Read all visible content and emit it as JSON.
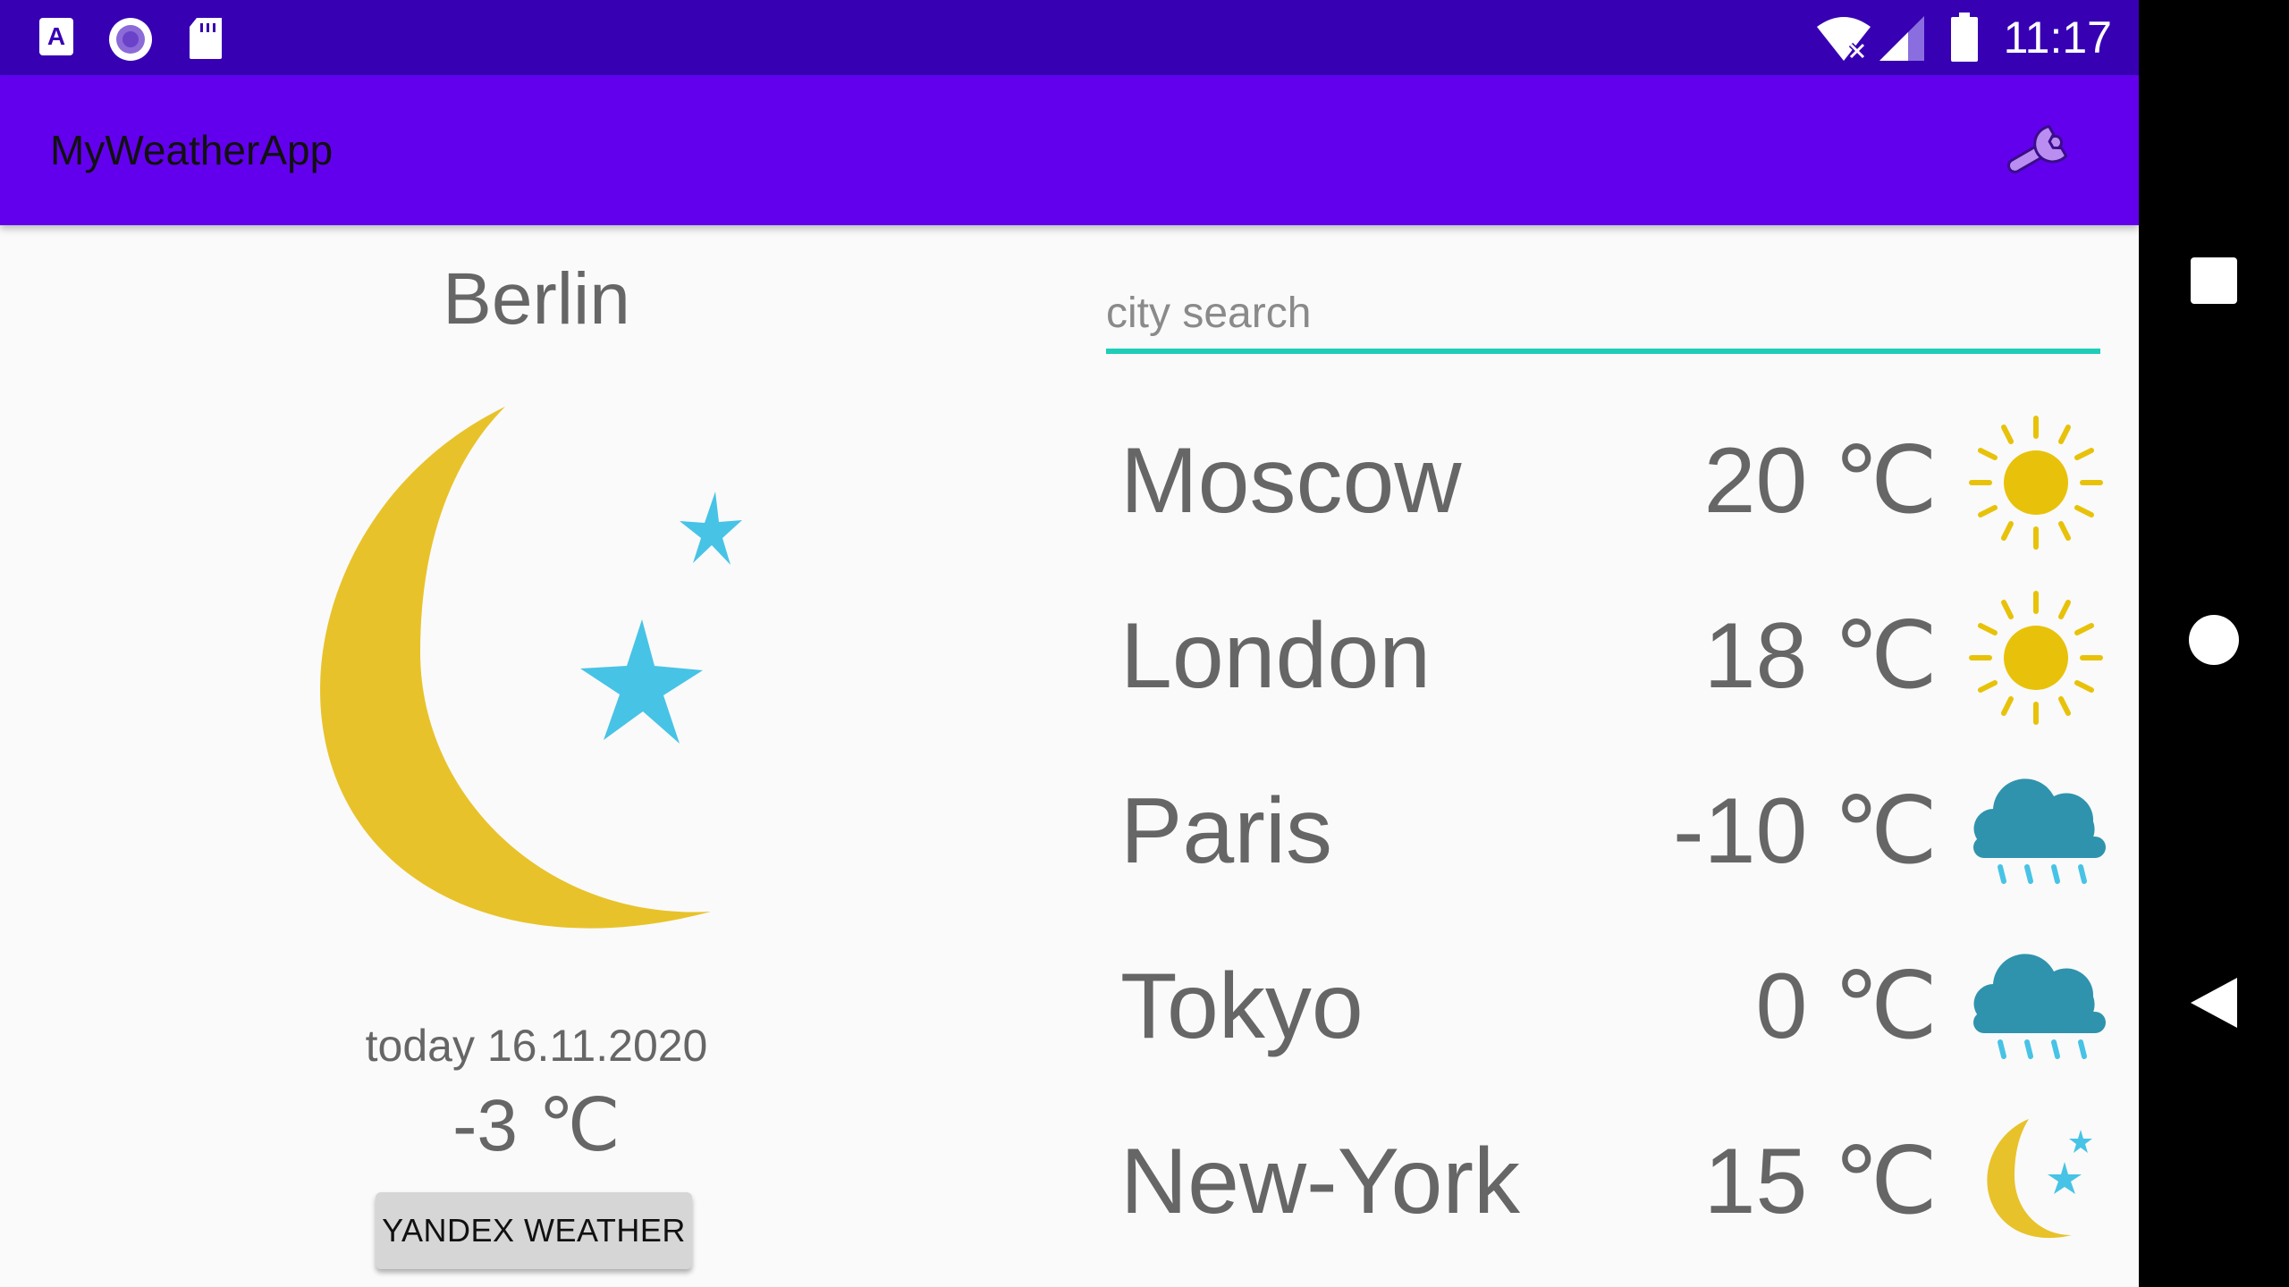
{
  "status_bar": {
    "time": "11:17",
    "icons": [
      "app-a-icon",
      "record-icon",
      "sd-card-icon",
      "wifi-icon",
      "signal-icon",
      "battery-icon"
    ]
  },
  "app_bar": {
    "title": "MyWeatherApp",
    "settings_icon": "wrench-icon"
  },
  "current": {
    "city": "Berlin",
    "icon": "moon-stars-icon",
    "date_label": "today 16.11.2020",
    "temperature": "-3 ℃",
    "button_label": "YANDEX WEATHER"
  },
  "search": {
    "placeholder": "city search",
    "value": ""
  },
  "cities": [
    {
      "name": "Moscow",
      "temp": "20 ℃",
      "icon": "sun-icon"
    },
    {
      "name": "London",
      "temp": "18 ℃",
      "icon": "sun-icon"
    },
    {
      "name": "Paris",
      "temp": "-10 ℃",
      "icon": "rain-cloud-icon"
    },
    {
      "name": "Tokyo",
      "temp": "0 ℃",
      "icon": "rain-cloud-icon"
    },
    {
      "name": "New-York",
      "temp": "15 ℃",
      "icon": "moon-stars-icon"
    }
  ],
  "nav_bar": {
    "icons": [
      "overview-icon",
      "home-icon",
      "back-icon"
    ]
  },
  "colors": {
    "status_bar": "#3700b3",
    "app_bar": "#6200ee",
    "accent": "#1dcdb8",
    "moon": "#e8c22a",
    "star": "#47c3e6",
    "sun": "#e8c20a",
    "cloud": "#2f93ad",
    "rain": "#47c3e6"
  }
}
